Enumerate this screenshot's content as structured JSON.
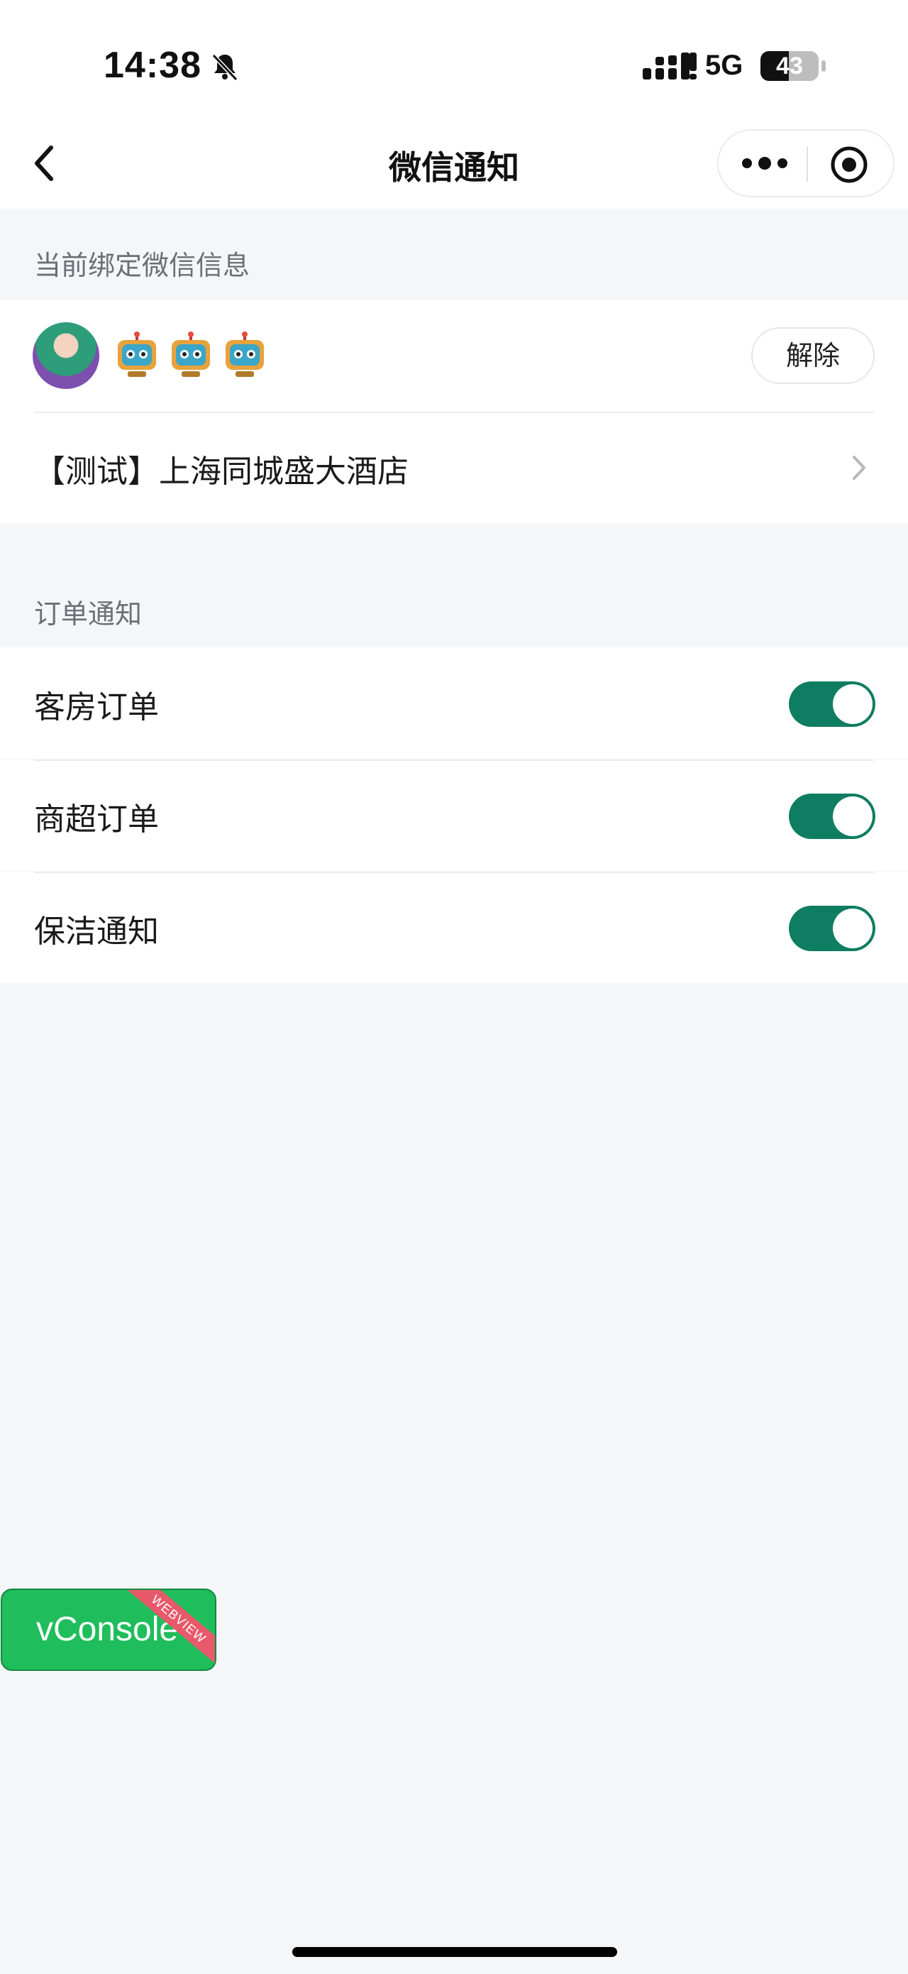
{
  "status_bar": {
    "time": "14:38",
    "network": "5G",
    "battery": "43",
    "icons": [
      "bell-muted-icon",
      "signal-icon",
      "battery-icon"
    ]
  },
  "nav": {
    "title": "微信通知",
    "icons": [
      "chevron-left-icon",
      "more-icon",
      "target-icon"
    ]
  },
  "bound_section": {
    "header": "当前绑定微信信息",
    "robot_emoji_count": 3,
    "unbind_label": "解除",
    "hotel_name": "【测试】上海同城盛大酒店"
  },
  "order_section": {
    "header": "订单通知",
    "items": [
      {
        "label": "客房订单",
        "enabled": true
      },
      {
        "label": "商超订单",
        "enabled": true
      },
      {
        "label": "保洁通知",
        "enabled": true
      }
    ]
  },
  "vconsole": {
    "label": "vConsole",
    "ribbon": "WEBVIEW",
    "color": "#1fbd5b"
  },
  "colors": {
    "toggle_on": "#0e7d62",
    "page_bg": "#f5f6f8"
  }
}
